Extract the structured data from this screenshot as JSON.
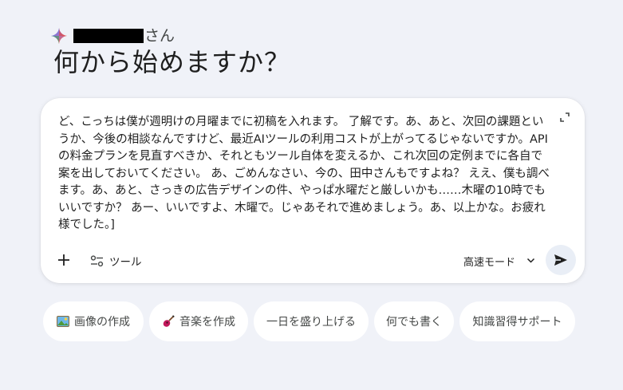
{
  "greeting": {
    "suffix": "さん",
    "headline": "何から始めますか？"
  },
  "composer": {
    "text": "ど、こっちは僕が週明けの月曜までに初稿を入れます。 了解です。あ、あと、次回の課題というか、今後の相談なんですけど、最近AIツールの利用コストが上がってるじゃないですか。APIの料金プランを見直すべきか、それともツール自体を変えるか、これ次回の定例までに各自で案を出しておいてください。 あ、ごめんなさい、今の、田中さんもですよね？ ええ、僕も調べます。あ、あと、さっきの広告デザインの件、やっぱ水曜だと厳しいかも……木曜の10時でもいいですか？ あー、いいですよ、木曜で。じゃあそれで進めましょう。あ、以上かな。お疲れ様でした。]",
    "tools_label": "ツール",
    "mode_label": "高速モード"
  },
  "chips": [
    {
      "label": "画像の作成",
      "icon": "image-emoji-icon"
    },
    {
      "label": "音楽を作成",
      "icon": "guitar-emoji-icon"
    },
    {
      "label": "一日を盛り上げる",
      "icon": ""
    },
    {
      "label": "何でも書く",
      "icon": ""
    },
    {
      "label": "知識習得サポート",
      "icon": ""
    }
  ],
  "colors": {
    "background": "#f0f2f8",
    "surface": "#ffffff",
    "send_bg": "#e9eef6"
  }
}
